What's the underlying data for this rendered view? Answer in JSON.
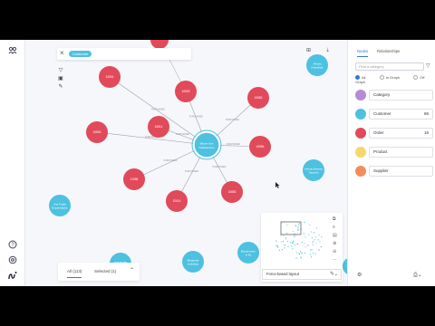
{
  "search": {
    "chip_label": "Customer"
  },
  "graph": {
    "colors": {
      "category": "#b58ad6",
      "customer": "#4dc1e0",
      "order": "#e04a5a",
      "product": "#f5d86a",
      "supplier": "#f28e5b",
      "edge": "#9aa0aa",
      "canvas": "#f6f7fb"
    },
    "center": {
      "label": "Blauer See Delikatessen",
      "edge_labels": [
        "PURCHASED",
        "PURCHASED",
        "PURCHASED",
        "PURCHASED",
        "PURCHASED",
        "PURCHASED",
        "PURCHASED",
        "PURCHASED",
        "PURCHASED"
      ]
    },
    "orders": [
      {
        "label": "10501"
      },
      {
        "label": "10509"
      },
      {
        "label": "10582"
      },
      {
        "label": "10614"
      },
      {
        "label": "10853"
      },
      {
        "label": "10956"
      },
      {
        "label": "11058"
      },
      {
        "label": "10614"
      },
      {
        "label": "10853"
      }
    ],
    "customers": [
      {
        "label": "Alfreds Futterkiste"
      },
      {
        "label": "Ana Trujillo Emparedados"
      },
      {
        "label": "Antonio Moreno Taquería"
      },
      {
        "label": "Around the Horn"
      },
      {
        "label": "Berglunds snabbköp"
      },
      {
        "label": "Blondel père et fils"
      }
    ]
  },
  "bottom_tabs": {
    "all": "All (113)",
    "selected": "Selected (1)"
  },
  "layout_select": {
    "value": "Force-based layout"
  },
  "right_panel": {
    "tabs": {
      "active": "Nodes",
      "inactive": "Relationships"
    },
    "search_placeholder": "Find a category",
    "radios": {
      "all": "All",
      "in_graph": "In Graph",
      "off_graph": "Off Graph"
    },
    "categories": [
      {
        "name": "Category",
        "count": "",
        "color": "#b58ad6"
      },
      {
        "name": "Customer",
        "count": "86",
        "color": "#4dc1e0"
      },
      {
        "name": "Order",
        "count": "16",
        "color": "#e04a5a"
      },
      {
        "name": "Product",
        "count": "",
        "color": "#f5d86a"
      },
      {
        "name": "Supplier",
        "count": "",
        "color": "#f28e5b"
      }
    ]
  },
  "icons": {
    "leftbar_top": "perspective-icon",
    "help": "help-icon",
    "settings": "settings-icon",
    "logo": "bloom-logo-icon",
    "close": "close-icon",
    "expand": "expand-icon",
    "download": "download-icon",
    "filter": "filter-icon",
    "chevron": "chevron-down-icon",
    "edit": "edit-icon"
  }
}
